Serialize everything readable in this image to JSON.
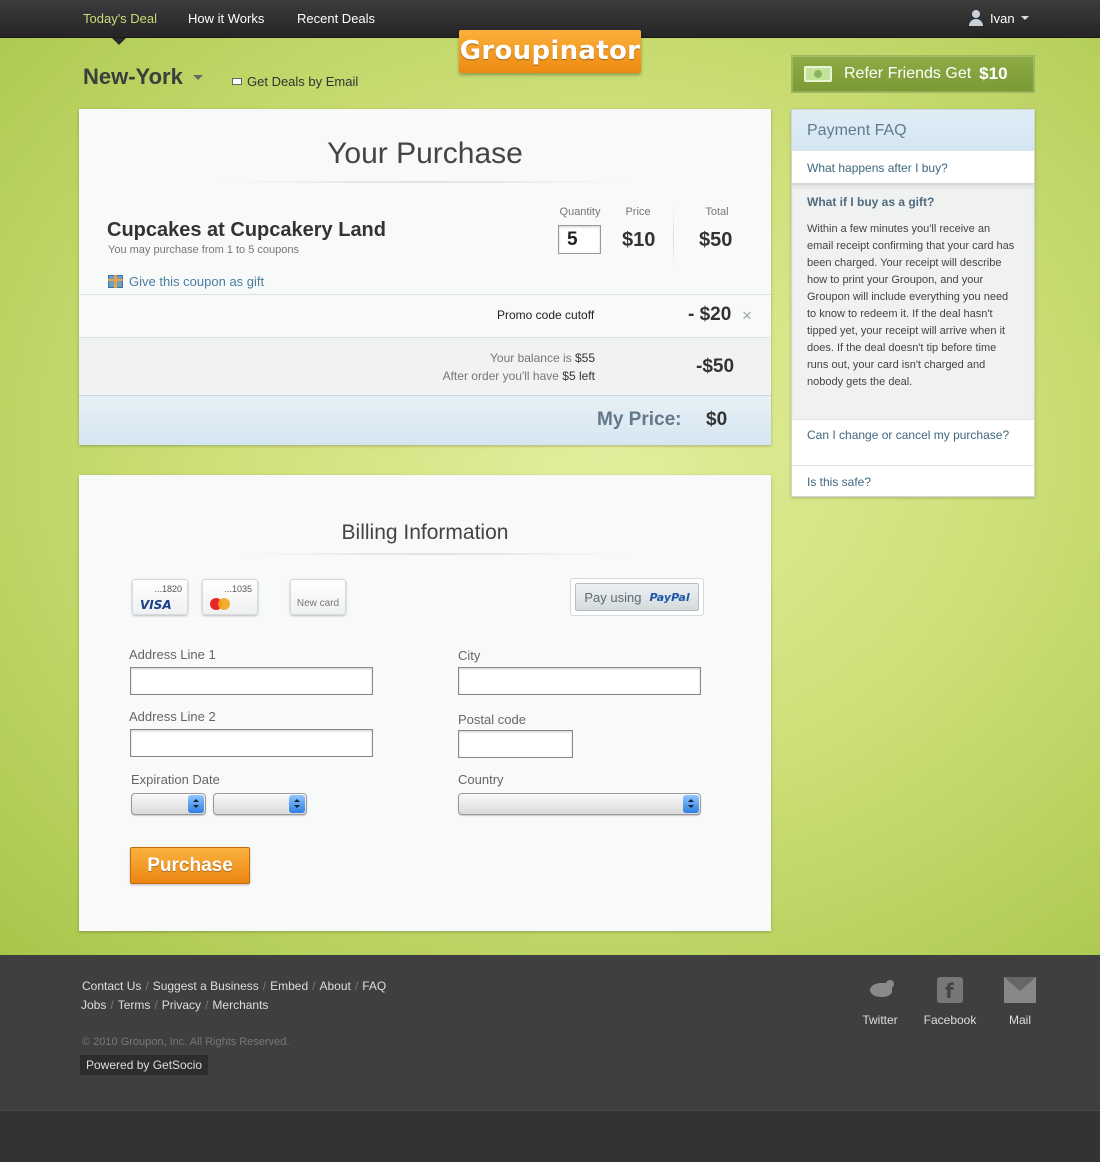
{
  "topnav": {
    "items": [
      {
        "label": "Today's Deal"
      },
      {
        "label": "How it Works"
      },
      {
        "label": "Recent Deals"
      }
    ],
    "user": "Ivan"
  },
  "brand": {
    "logo": "Groupinator",
    "accent": "#f29a21"
  },
  "location": {
    "city": "New-York",
    "email_link": "Get Deals by Email"
  },
  "refer": {
    "label": "Refer Friends Get",
    "amount": "$10"
  },
  "purchase": {
    "title": "Your Purchase",
    "deal_name": "Cupcakes at Cupcakery Land",
    "deal_sub": "You may purchase from 1 to 5 coupons",
    "gift_link": "Give this coupon as gift",
    "headers": {
      "quantity": "Quantity",
      "price": "Price",
      "total": "Total"
    },
    "quantity": "5",
    "price": "$10",
    "total": "$50",
    "promo_label": "Promo code cutoff",
    "promo_value": "- $20",
    "promo_remove": "×",
    "balance_text": "Your balance is",
    "balance_amount": "$55",
    "after_text": "After order you'll have",
    "after_amount": "$5 left",
    "balance_value": "-$50",
    "my_price_label": "My Price:",
    "my_price_value": "$0"
  },
  "billing": {
    "title": "Billing Information",
    "cards": [
      {
        "number": "...1820",
        "brand": "VISA"
      },
      {
        "number": "...1035",
        "brand": "mastercard"
      }
    ],
    "new_card": "New card",
    "paypal_text": "Pay using",
    "paypal_logo": "PayPal",
    "labels": {
      "address1": "Address Line 1",
      "address2": "Address Line 2",
      "expiration": "Expiration Date",
      "city": "City",
      "postal": "Postal code",
      "country": "Country"
    },
    "values": {
      "address1": "",
      "address2": "",
      "city": "",
      "postal": ""
    },
    "purchase_button": "Purchase"
  },
  "faq": {
    "title": "Payment FAQ",
    "q1": "What happens after I buy?",
    "open_q": "What if I buy as a gift?",
    "open_a": "Within a few minutes you'll receive an email receipt confirming that your card has been charged. Your receipt will describe how to print your Groupon, and your Groupon will include everything you need to know to redeem it. If the deal hasn't tipped yet, your receipt will arrive when it does. If the deal doesn't tip before time runs out, your card isn't charged and nobody gets the deal.",
    "q3": "Can I change or cancel my purchase?",
    "q4": "Is this safe?"
  },
  "footer": {
    "links_row1": [
      "Contact Us",
      "Suggest a Business",
      "Embed",
      "About",
      "FAQ"
    ],
    "links_row2": [
      "Jobs",
      "Terms",
      "Privacy",
      "Merchants"
    ],
    "copyright": "© 2010 Groupon, Inc. All Rights Reserved.",
    "powered": "Powered by GetSocio",
    "social": [
      {
        "label": "Twitter",
        "icon": "twitter-icon"
      },
      {
        "label": "Facebook",
        "icon": "facebook-icon"
      },
      {
        "label": "Mail",
        "icon": "mail-icon"
      }
    ]
  }
}
